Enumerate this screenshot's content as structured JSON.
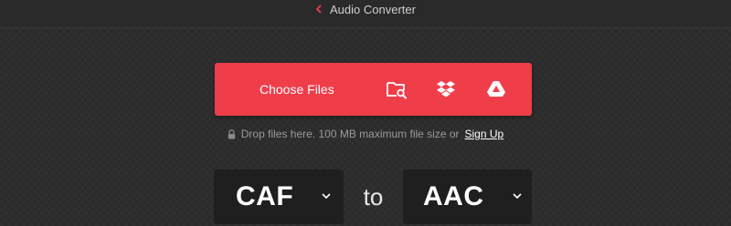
{
  "header": {
    "breadcrumb_label": "Audio Converter",
    "back_icon": "chevron-left-icon",
    "accent": "#ef3e4a"
  },
  "upload": {
    "choose_label": "Choose Files",
    "button_color": "#ef3e4a",
    "sources": [
      {
        "name": "device",
        "icon": "folder-search-icon"
      },
      {
        "name": "dropbox",
        "icon": "dropbox-icon"
      },
      {
        "name": "google-drive",
        "icon": "google-drive-icon"
      }
    ],
    "hint_text": "Drop files here. 100 MB maximum file size or",
    "signup_label": "Sign Up",
    "lock_icon": "lock-icon"
  },
  "conversion": {
    "from_format": "CAF",
    "connector": "to",
    "to_format": "AAC",
    "dropdown_icon": "chevron-down-icon"
  }
}
